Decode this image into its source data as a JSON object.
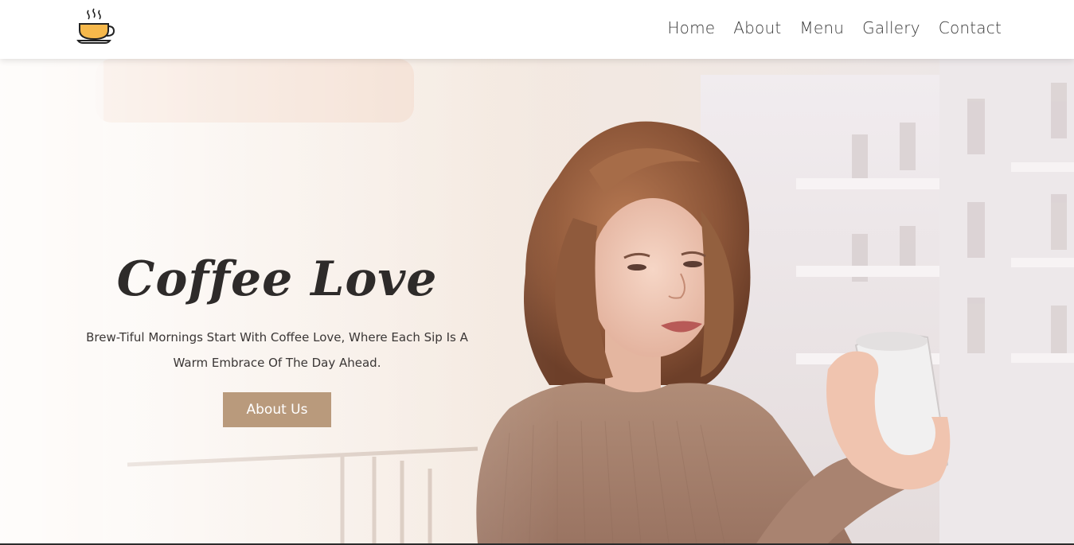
{
  "header": {
    "logo_icon": "coffee-cup-icon",
    "nav": [
      {
        "label": "Home"
      },
      {
        "label": "About"
      },
      {
        "label": "Menu"
      },
      {
        "label": "Gallery"
      },
      {
        "label": "Contact"
      }
    ]
  },
  "hero": {
    "title": "Coffee Love",
    "subtitle": "Brew-Tiful Mornings Start With Coffee Love, Where Each Sip Is A Warm Embrace Of The Day Ahead.",
    "button_label": "About Us",
    "image_description": "woman-holding-coffee-mug-on-balcony"
  },
  "colors": {
    "button_bg": "#b99a7c",
    "title_text": "#2e2b2a",
    "nav_text": "#3a3a3a",
    "cup_fill": "#f6b84b"
  }
}
